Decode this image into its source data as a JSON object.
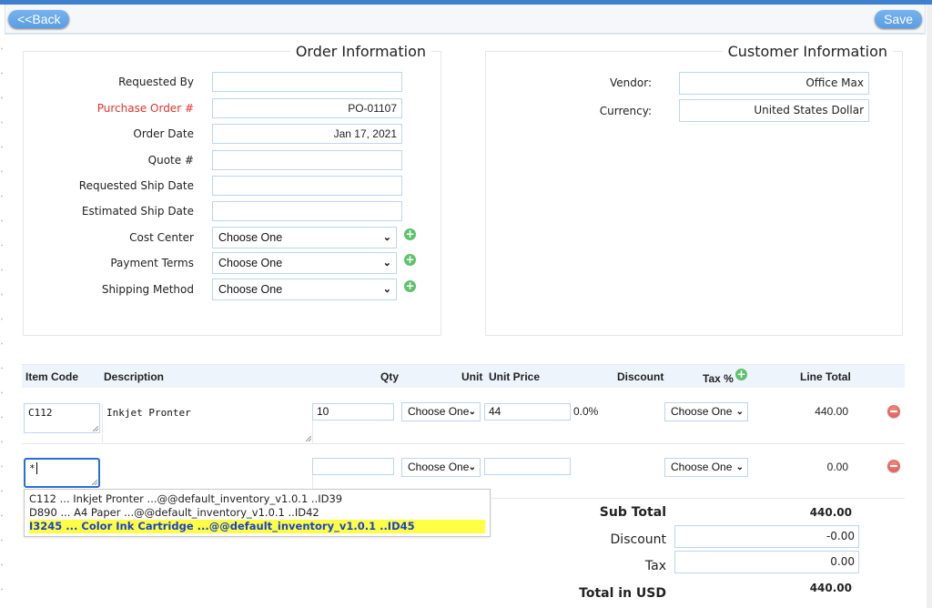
{
  "toolbar": {
    "back_label": "<<Back",
    "save_label": "Save"
  },
  "order_info": {
    "title": "Order Information",
    "fields": [
      {
        "label": "Requested By",
        "value": "",
        "required": false
      },
      {
        "label": "Purchase Order #",
        "value": "PO-01107",
        "required": true
      },
      {
        "label": "Order Date",
        "value": "Jan 17, 2021",
        "required": false
      },
      {
        "label": "Quote #",
        "value": "",
        "required": false
      },
      {
        "label": "Requested Ship Date",
        "value": "",
        "required": false
      },
      {
        "label": "Estimated Ship Date",
        "value": "",
        "required": false
      }
    ],
    "selects": [
      {
        "label": "Cost Center",
        "value": "Choose One"
      },
      {
        "label": "Payment Terms",
        "value": "Choose One"
      },
      {
        "label": "Shipping Method",
        "value": "Choose One"
      }
    ]
  },
  "customer_info": {
    "title": "Customer Information",
    "fields": [
      {
        "label": "Vendor:",
        "value": "Office Max"
      },
      {
        "label": "Currency:",
        "value": "United States Dollar"
      }
    ]
  },
  "line_items": {
    "headers": {
      "item_code": "Item Code",
      "description": "Description",
      "qty": "Qty",
      "unit": "Unit",
      "unit_price": "Unit Price",
      "discount": "Discount",
      "tax": "Tax %",
      "line_total": "Line Total"
    },
    "rows": [
      {
        "item_code": "C112",
        "description": "Inkjet Pronter",
        "qty": "10",
        "unit": "Choose One",
        "unit_price": "44",
        "discount": "0.0%",
        "tax": "Choose One",
        "line_total": "440.00"
      },
      {
        "item_code": "*",
        "description": "",
        "qty": "",
        "unit": "Choose One",
        "unit_price": "",
        "discount": "",
        "tax": "Choose One",
        "line_total": "0.00"
      }
    ]
  },
  "autocomplete": {
    "items": [
      {
        "text": "C112 ... Inkjet Pronter ...@@default_inventory_v1.0.1 ..ID39",
        "highlighted": false
      },
      {
        "text": "D890 ... A4 Paper ...@@default_inventory_v1.0.1 ..ID42",
        "highlighted": false
      },
      {
        "text": "I3245 ... Color Ink Cartridge ...@@default_inventory_v1.0.1 ..ID45",
        "highlighted": true
      }
    ]
  },
  "totals": {
    "subtotal_label": "Sub Total",
    "subtotal_value": "440.00",
    "discount_label": "Discount",
    "discount_value": "-0.00",
    "tax_label": "Tax",
    "tax_value": "0.00",
    "total_label": "Total in USD",
    "total_value": "440.00"
  },
  "colors": {
    "accent": "#5a9de4",
    "required_label": "#e0332b",
    "highlight": "#ffff44",
    "add": "#5cc26b",
    "remove": "#d9534f"
  }
}
